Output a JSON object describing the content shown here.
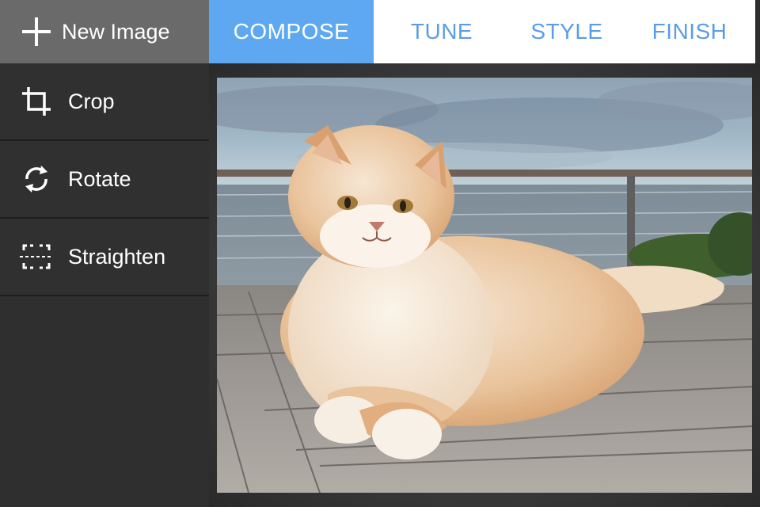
{
  "header": {
    "new_image_label": "New Image"
  },
  "tabs": [
    {
      "label": "COMPOSE",
      "active": true
    },
    {
      "label": "TUNE",
      "active": false
    },
    {
      "label": "STYLE",
      "active": false
    },
    {
      "label": "FINISH",
      "active": false
    }
  ],
  "sidebar": {
    "tools": [
      {
        "label": "Crop",
        "icon": "crop-icon"
      },
      {
        "label": "Rotate",
        "icon": "rotate-icon"
      },
      {
        "label": "Straighten",
        "icon": "straighten-icon"
      }
    ]
  },
  "canvas": {
    "image_subject": "cat-photo"
  },
  "colors": {
    "accent": "#5ea8f2",
    "tab_text": "#5c9ce6",
    "sidebar_bg": "#303030",
    "new_image_bg": "#6a6a6a"
  }
}
